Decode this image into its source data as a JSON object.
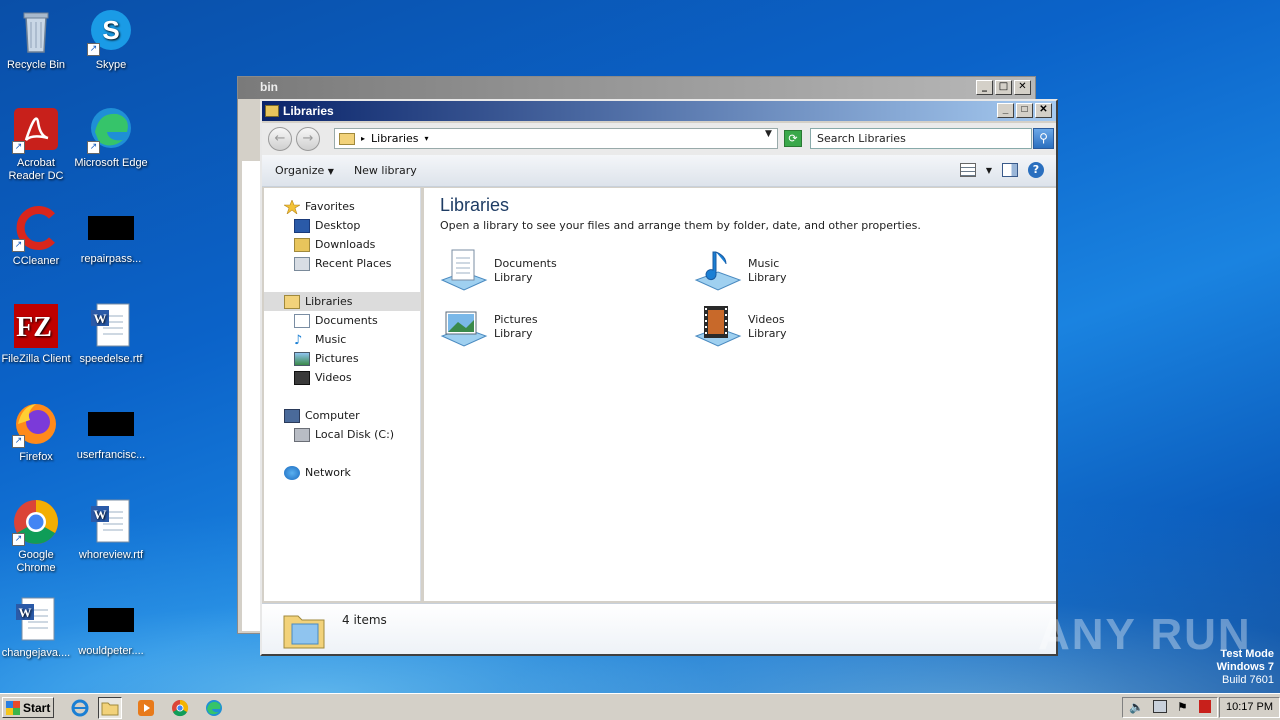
{
  "desktop": {
    "icons": [
      {
        "label": "Recycle Bin",
        "icon": "recycle-bin-icon"
      },
      {
        "label": "Skype",
        "icon": "skype-icon"
      },
      {
        "label": "Acrobat Reader DC",
        "icon": "acrobat-icon"
      },
      {
        "label": "Microsoft Edge",
        "icon": "edge-icon"
      },
      {
        "label": "CCleaner",
        "icon": "ccleaner-icon"
      },
      {
        "label": "repairpass...",
        "icon": "redacted-icon"
      },
      {
        "label": "FileZilla Client",
        "icon": "filezilla-icon"
      },
      {
        "label": "speedelse.rtf",
        "icon": "word-doc-icon"
      },
      {
        "label": "Firefox",
        "icon": "firefox-icon"
      },
      {
        "label": "userfrancisc...",
        "icon": "redacted-icon"
      },
      {
        "label": "Google Chrome",
        "icon": "chrome-icon"
      },
      {
        "label": "whoreview.rtf",
        "icon": "word-doc-icon"
      },
      {
        "label": "changejava....",
        "icon": "word-doc-icon"
      },
      {
        "label": "wouldpeter....",
        "icon": "redacted-icon"
      }
    ]
  },
  "back_window": {
    "title": "bin"
  },
  "explorer": {
    "title": "Libraries",
    "address": {
      "crumb": "Libraries"
    },
    "search": {
      "placeholder": "Search Libraries"
    },
    "toolbar": {
      "organize": "Organize",
      "new_library": "New library"
    },
    "nav": {
      "favorites": "Favorites",
      "desktop": "Desktop",
      "downloads": "Downloads",
      "recent": "Recent Places",
      "libraries": "Libraries",
      "documents": "Documents",
      "music": "Music",
      "pictures": "Pictures",
      "videos": "Videos",
      "computer": "Computer",
      "local_disk": "Local Disk (C:)",
      "network": "Network"
    },
    "content": {
      "heading": "Libraries",
      "description": "Open a library to see your files and arrange them by folder, date, and other properties.",
      "libraries": [
        {
          "name": "Documents",
          "type": "Library"
        },
        {
          "name": "Music",
          "type": "Library"
        },
        {
          "name": "Pictures",
          "type": "Library"
        },
        {
          "name": "Videos",
          "type": "Library"
        }
      ]
    },
    "details": {
      "count": "4 items"
    }
  },
  "taskbar": {
    "start": "Start",
    "clock": "10:17 PM"
  },
  "watermark": {
    "line1": "Test Mode",
    "line2": "Windows 7",
    "line3": "Build 7601",
    "brand": "ANY RUN"
  }
}
